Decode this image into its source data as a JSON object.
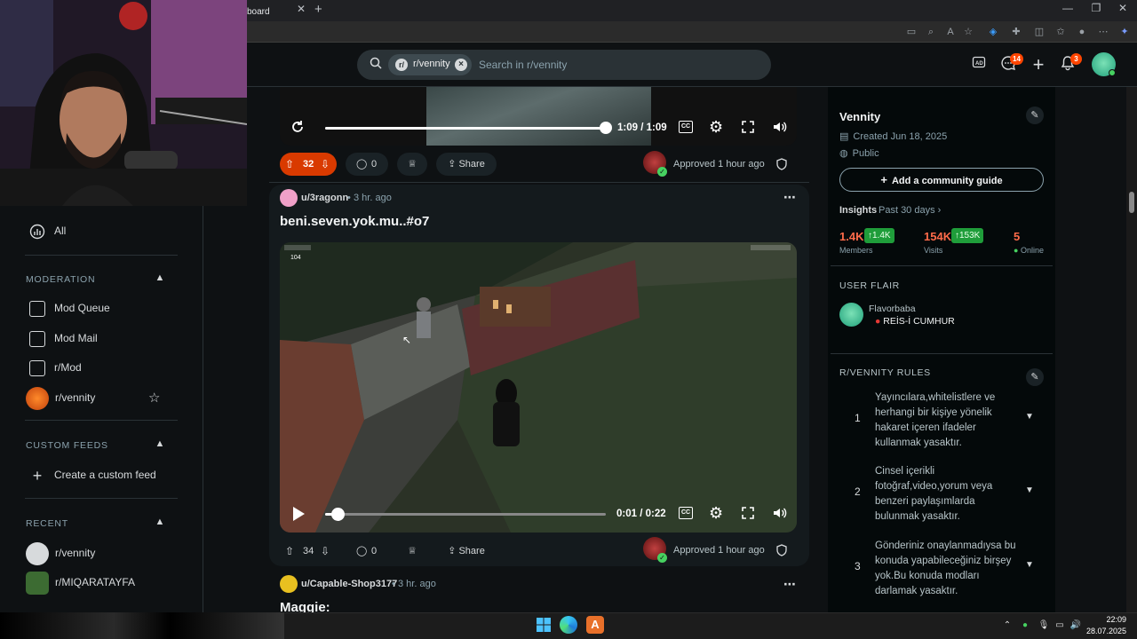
{
  "browser": {
    "tab_title": "board",
    "tab_close": "✕",
    "new_tab": "+",
    "win_min": "—",
    "win_restore": "❐",
    "win_close": "✕"
  },
  "header": {
    "search_chip": "r/vennity",
    "search_placeholder": "Search in r/vennity",
    "chat_badge": "14",
    "notif_badge": "3"
  },
  "left_sidebar": {
    "all_label": "All",
    "moderation_label": "MODERATION",
    "mod_queue": "Mod Queue",
    "mod_mail": "Mod Mail",
    "r_mod": "r/Mod",
    "r_vennity": "r/vennity",
    "custom_feeds_label": "CUSTOM FEEDS",
    "create_custom_feed": "Create a custom feed",
    "recent_label": "RECENT",
    "recent_1": "r/vennity",
    "recent_2": "r/MIQARATAYFA"
  },
  "post1": {
    "time": "1:09 / 1:09",
    "progress": 1.0,
    "votes": "32",
    "comments": "0",
    "share": "Share",
    "approved": "Approved 1 hour ago"
  },
  "post2": {
    "user": "u/3ragonn",
    "age": "3 hr. ago",
    "title": "beni.seven.yok.mu..#o7",
    "hud_count": "104",
    "time": "0:01 / 0:22",
    "progress": 0.045,
    "votes": "34",
    "comments": "0",
    "share": "Share",
    "approved": "Approved 1 hour ago"
  },
  "post3": {
    "user": "u/Capable-Shop3177",
    "age": "3 hr. ago",
    "title": "Maggie:"
  },
  "community": {
    "name": "Vennity",
    "created": "Created Jun 18, 2025",
    "visibility": "Public",
    "add_guide": "Add a community guide",
    "insights_label": "Insights",
    "insights_range": "Past 30 days ›",
    "members": "1.4K",
    "members_change": "↑1.4K",
    "members_label": "Members",
    "visits": "154K",
    "visits_change": "↑153K",
    "visits_label": "Visits",
    "online": "5",
    "online_label": "Online",
    "user_flair_label": "USER FLAIR",
    "flair_user": "Flavorbaba",
    "flair_text": "REİS-İ CUMHUR",
    "rules_label": "R/VENNITY RULES",
    "rules": [
      {
        "num": "1",
        "text": "Yayıncılara,whitelistlere ve herhangi bir kişiye yönelik hakaret içeren ifadeler kullanmak yasaktır."
      },
      {
        "num": "2",
        "text": "Cinsel içerikli fotoğraf,video,yorum veya benzeri paylaşımlarda bulunmak yasaktır."
      },
      {
        "num": "3",
        "text": "Gönderiniz onaylanmadıysa bu konuda yapabileceğiniz birşey yok.Bu konuda modları darlamak yasaktır."
      }
    ]
  },
  "taskbar": {
    "time": "22:09",
    "date": "28.07.2025"
  }
}
